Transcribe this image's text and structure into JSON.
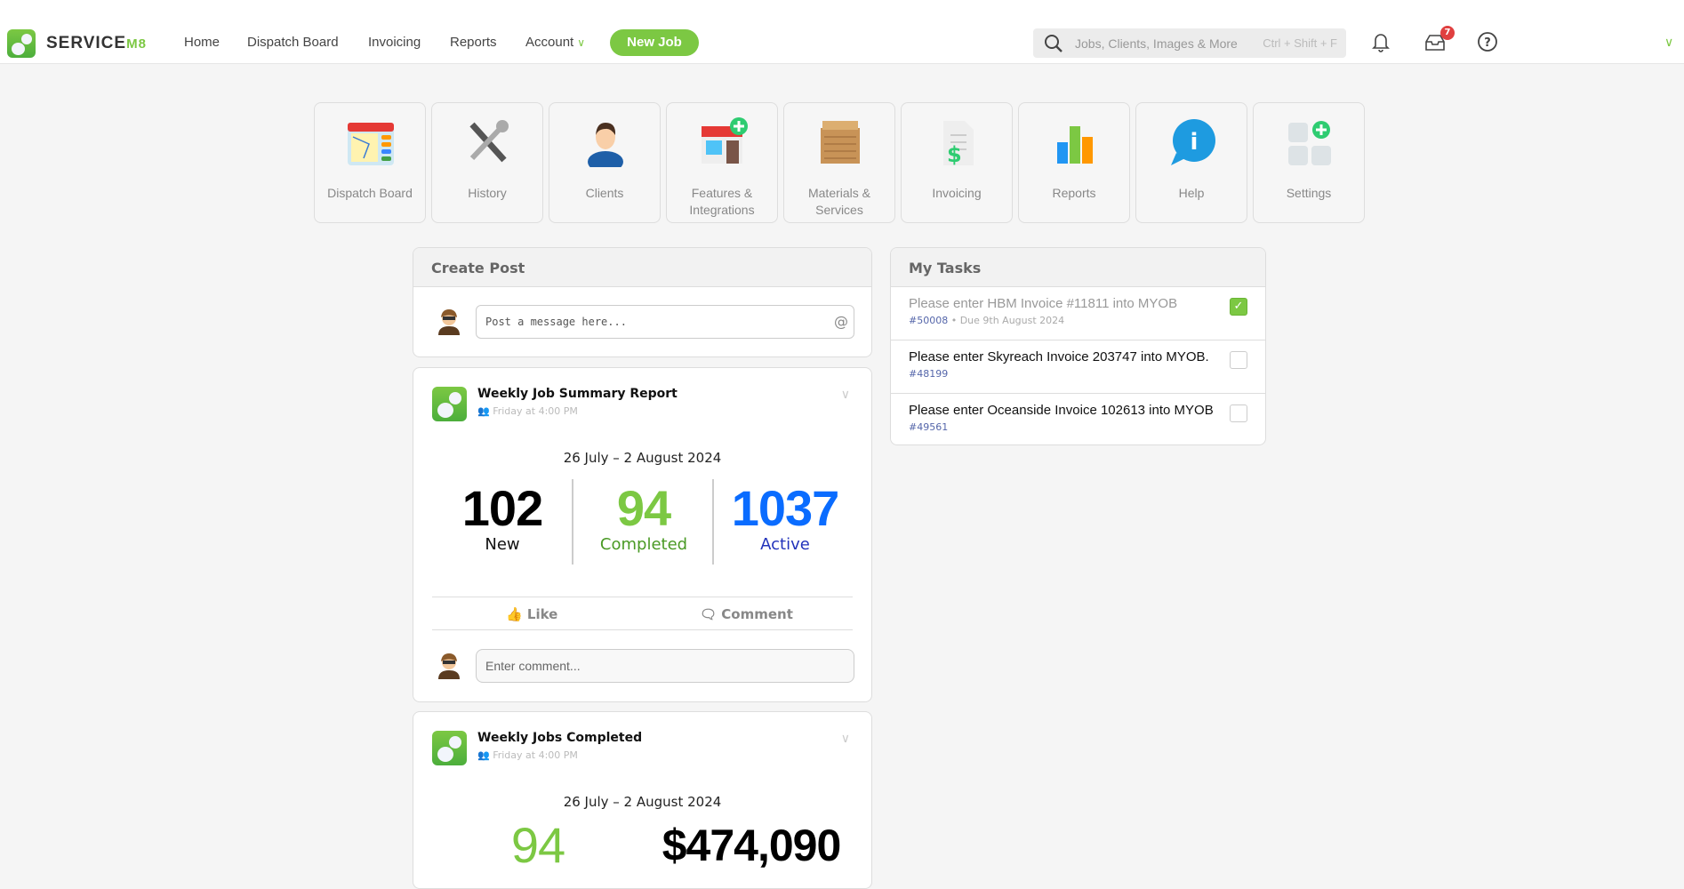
{
  "header": {
    "brand": "SERVICE",
    "brand_suffix": "M8",
    "nav": [
      {
        "label": "Home"
      },
      {
        "label": "Dispatch Board"
      },
      {
        "label": "Invoicing"
      },
      {
        "label": "Reports"
      },
      {
        "label": "Account"
      }
    ],
    "new_job": "New Job",
    "search_placeholder": "Jobs, Clients, Images & More",
    "search_shortcut": "Ctrl + Shift + F",
    "inbox_count": "7"
  },
  "tiles": [
    {
      "label": "Dispatch Board",
      "icon": "calendar-map-icon"
    },
    {
      "label": "History",
      "icon": "tools-icon"
    },
    {
      "label": "Clients",
      "icon": "person-icon"
    },
    {
      "label": "Features & Integrations",
      "icon": "store-plus-icon"
    },
    {
      "label": "Materials & Services",
      "icon": "crate-icon"
    },
    {
      "label": "Invoicing",
      "icon": "invoice-dollar-icon"
    },
    {
      "label": "Reports",
      "icon": "bar-chart-icon"
    },
    {
      "label": "Help",
      "icon": "info-bubble-icon"
    },
    {
      "label": "Settings",
      "icon": "settings-grid-icon"
    }
  ],
  "create_post": {
    "title": "Create Post",
    "placeholder": "Post a message here..."
  },
  "post1": {
    "title": "Weekly Job Summary Report",
    "time": "Friday at 4:00 PM",
    "range": "26 July – 2 August 2024",
    "stats": [
      {
        "value": "102",
        "label": "New"
      },
      {
        "value": "94",
        "label": "Completed"
      },
      {
        "value": "1037",
        "label": "Active"
      }
    ],
    "like": "Like",
    "comment": "Comment",
    "comment_placeholder": "Enter comment..."
  },
  "post2": {
    "title": "Weekly Jobs Completed",
    "time": "Friday at 4:00 PM",
    "range": "26 July – 2 August 2024",
    "completed": "94",
    "revenue": "$474,090"
  },
  "tasks": {
    "title": "My Tasks",
    "items": [
      {
        "text": "Please enter HBM Invoice #11811 into MYOB",
        "job": "#50008",
        "due": " • Due 9th August 2024",
        "done": true
      },
      {
        "text": "Please enter Skyreach Invoice 203747 into MYOB.",
        "job": "#48199",
        "due": "",
        "done": false
      },
      {
        "text": "Please enter Oceanside Invoice 102613 into MYOB",
        "job": "#49561",
        "due": "",
        "done": false
      }
    ]
  },
  "colors": {
    "accent": "#7cc843",
    "blue": "#0a6cff",
    "active_label": "#2233bb",
    "completed_label": "#4a9a25"
  }
}
